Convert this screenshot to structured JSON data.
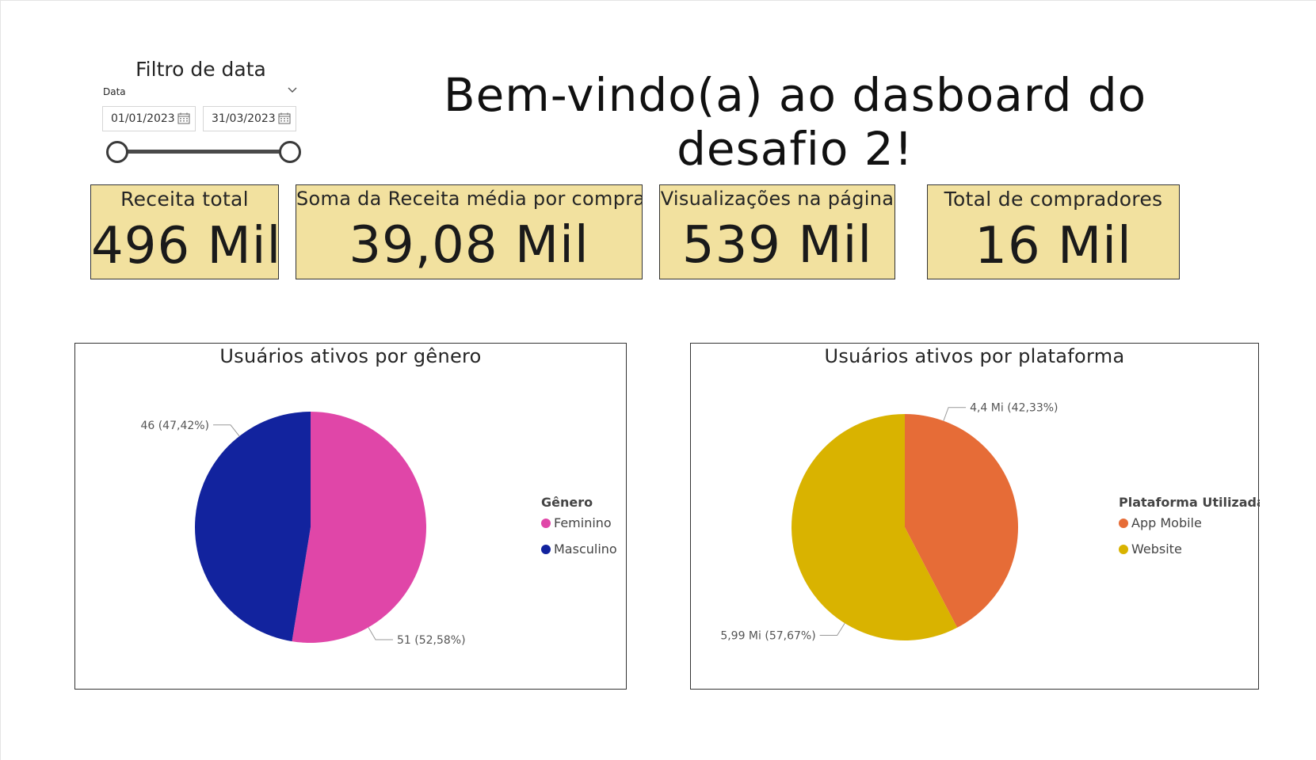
{
  "filter": {
    "title": "Filtro de data",
    "field_label": "Data",
    "start_date": "01/01/2023",
    "end_date": "31/03/2023",
    "range_start_fraction": 0,
    "range_end_fraction": 1
  },
  "page_title": "Bem-vindo(a) ao dasboard do desafio 2!",
  "kpis": [
    {
      "label": "Receita total",
      "value": "496 Mil"
    },
    {
      "label": "Soma da Receita média por compra",
      "value": "39,08 Mil"
    },
    {
      "label": "Visualizações na página",
      "value": "539 Mil"
    },
    {
      "label": "Total de compradores",
      "value": "16 Mil"
    }
  ],
  "colors": {
    "kpi_background": "#f2e19f",
    "feminino": "#e046a8",
    "masculino": "#12239e",
    "app_mobile": "#e66c37",
    "website": "#d9b300"
  },
  "chart_data": [
    {
      "type": "pie",
      "title": "Usuários ativos por gênero",
      "legend_title": "Gênero",
      "legend_position": "right",
      "slices": [
        {
          "name": "Feminino",
          "value": 51,
          "percent": 52.58,
          "label": "51 (52,58%)",
          "color": "#e046a8"
        },
        {
          "name": "Masculino",
          "value": 46,
          "percent": 47.42,
          "label": "46 (47,42%)",
          "color": "#12239e"
        }
      ]
    },
    {
      "type": "pie",
      "title": "Usuários ativos por plataforma",
      "legend_title": "Plataforma Utilizada",
      "legend_position": "right",
      "slices": [
        {
          "name": "App Mobile",
          "value": 4.4,
          "percent": 42.33,
          "label": "4,4 Mi (42,33%)",
          "color": "#e66c37"
        },
        {
          "name": "Website",
          "value": 5.99,
          "percent": 57.67,
          "label": "5,99 Mi (57,67%)",
          "color": "#d9b300"
        }
      ]
    }
  ]
}
